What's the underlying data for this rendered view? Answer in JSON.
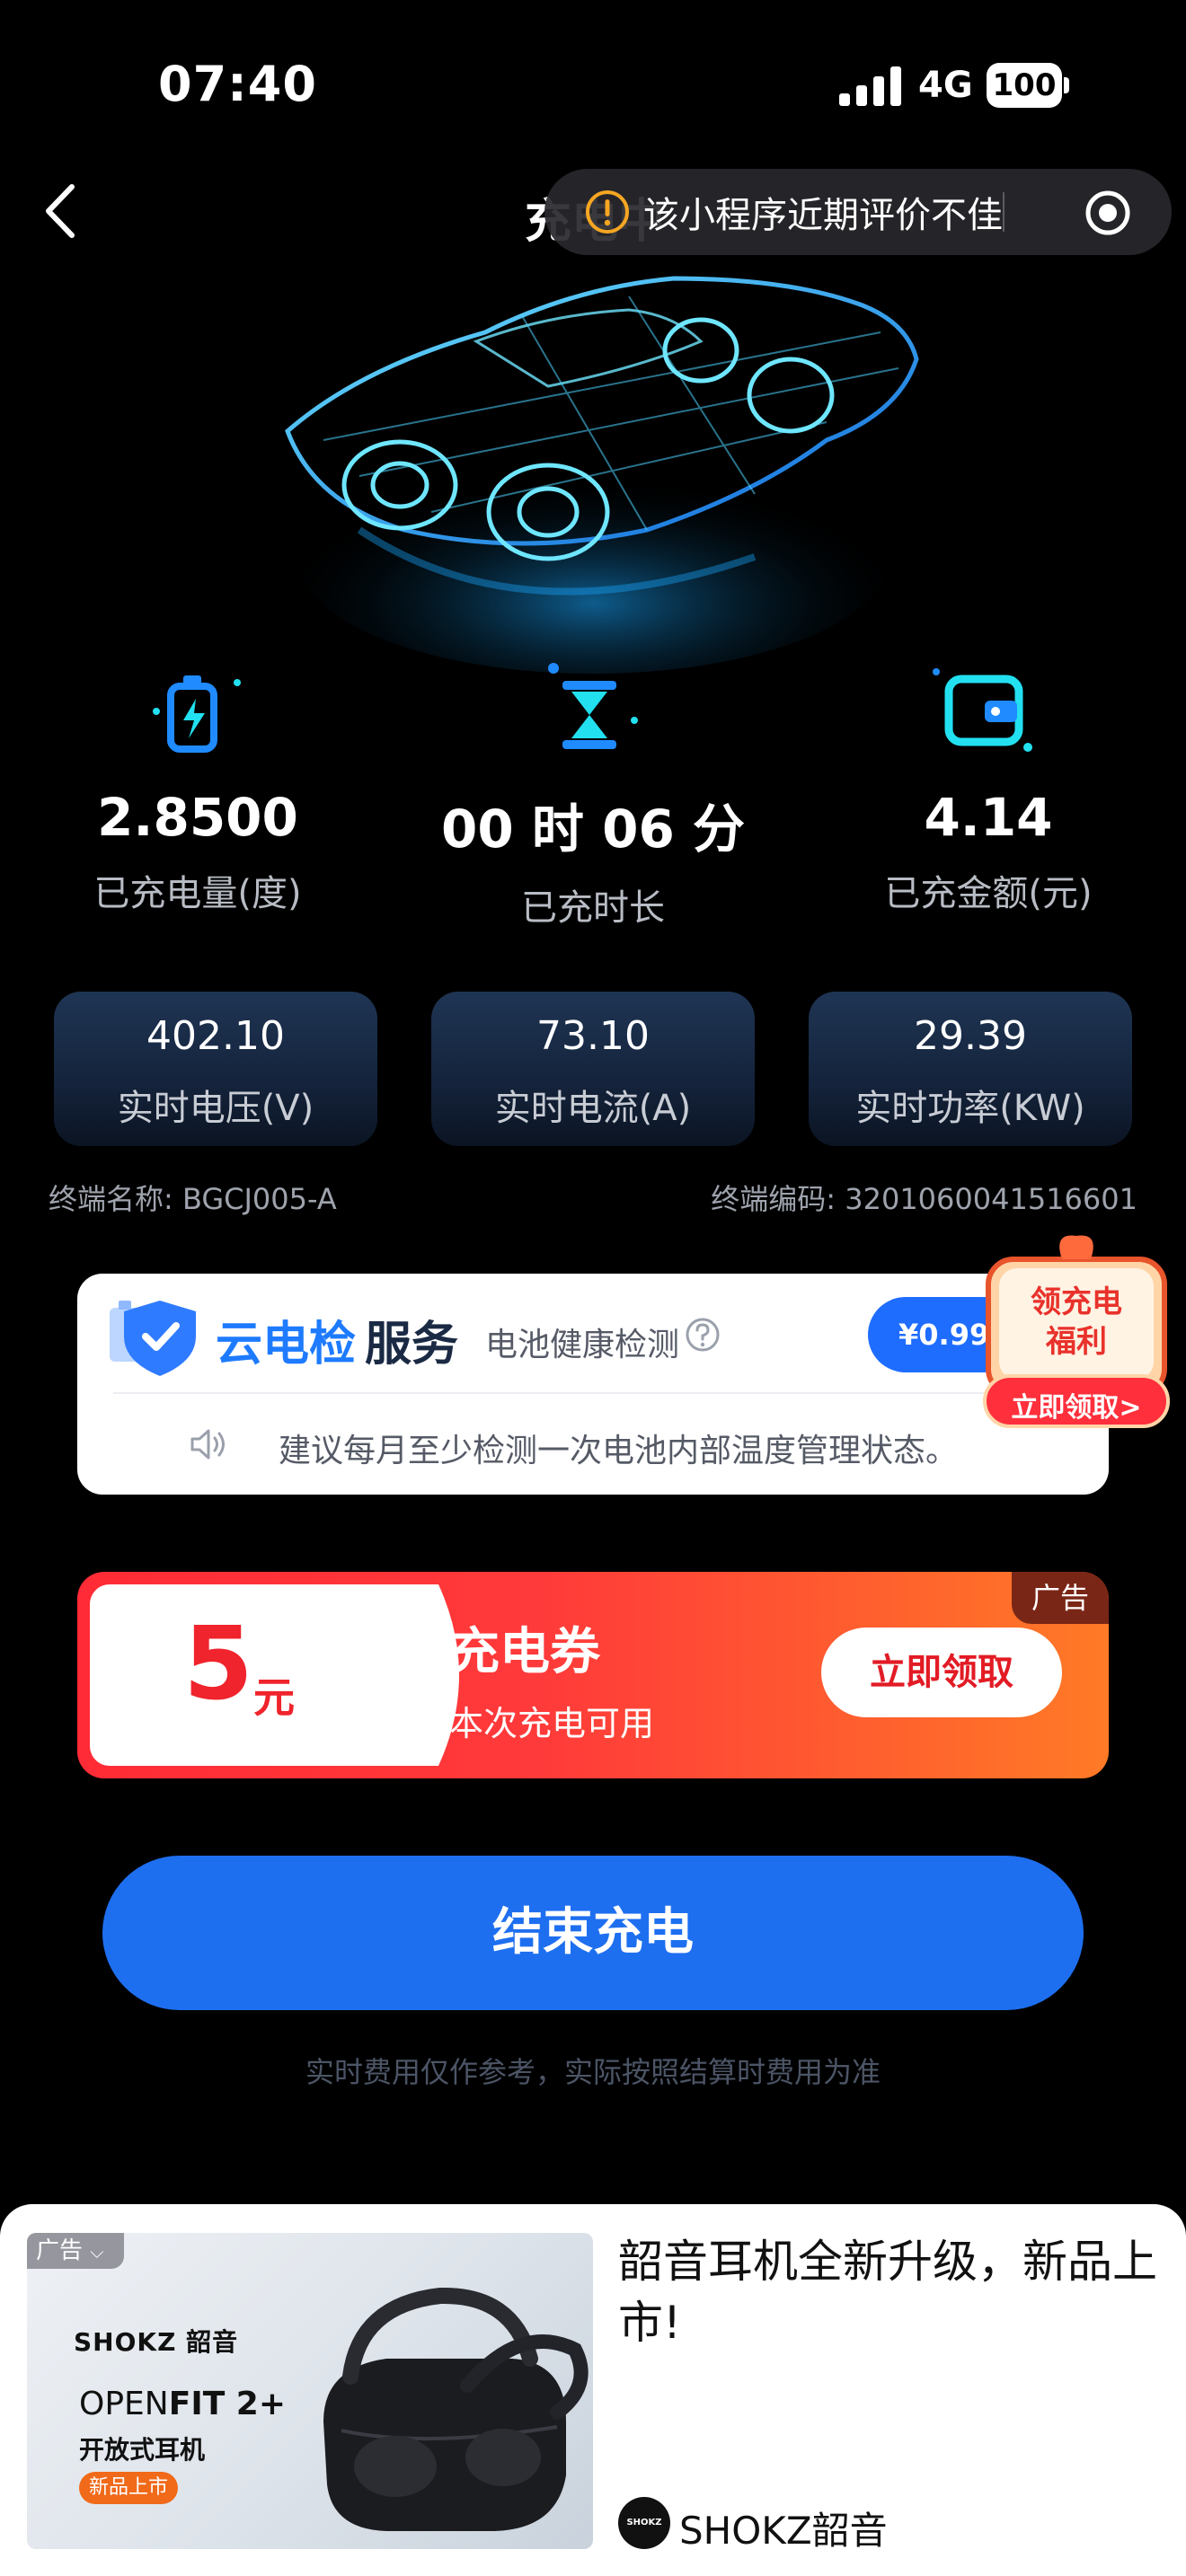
{
  "status_bar": {
    "time": "07:40",
    "network": "4G",
    "battery": "100"
  },
  "nav": {
    "title": "充电中",
    "capsule_text": "该小程序近期评价不佳",
    "icons": [
      "back-arrow-icon",
      "warning-icon",
      "target-icon"
    ]
  },
  "stats": [
    {
      "value": "2.8500",
      "label": "已充电量(度)",
      "icon": "battery-charge-icon"
    },
    {
      "value": "00 时 06 分",
      "label": "已充时长",
      "icon": "hourglass-icon"
    },
    {
      "value": "4.14",
      "label": "已充金额(元)",
      "icon": "wallet-icon"
    }
  ],
  "realtime": [
    {
      "value": "402.10",
      "label": "实时电压(V)"
    },
    {
      "value": "73.10",
      "label": "实时电流(A)"
    },
    {
      "value": "29.39",
      "label": "实时功率(KW)"
    }
  ],
  "terminal": {
    "name": "终端名称: BGCJ005-A",
    "code": "终端编码: 3201060041516601"
  },
  "battery_check": {
    "title_a": "云电检",
    "title_b": "服务",
    "subtitle": "电池健康检测",
    "price": "¥0.99",
    "tip": "建议每月至少检测一次电池内部温度管理状态。"
  },
  "benefit_badge": {
    "line1": "领充电",
    "line2": "福利",
    "button": "立即领取>"
  },
  "coupon": {
    "amount": "5",
    "unit": "元",
    "title": "充电券",
    "desc": "本次充电可用",
    "button": "立即领取",
    "ad_tag": "广告"
  },
  "end_button": "结束充电",
  "disclaimer": "实时费用仅作参考，实际按照结算时费用为准",
  "bottom_ad": {
    "tag": "广告",
    "image_brand": "SHOKZ 韶音",
    "image_product_a": "OPEN",
    "image_product_b": "FIT 2+",
    "image_subtitle": "开放式耳机",
    "image_badge": "新品上市",
    "headline": "韶音耳机全新升级，新品上市!",
    "advertiser": "SHOKZ韶音",
    "logo_text": "SHOKZ"
  },
  "colors": {
    "accent_blue": "#1e6ff0",
    "coupon_red": "#ff2b36",
    "icon_blue": "#1f8bff",
    "icon_cyan": "#22e0f0"
  }
}
